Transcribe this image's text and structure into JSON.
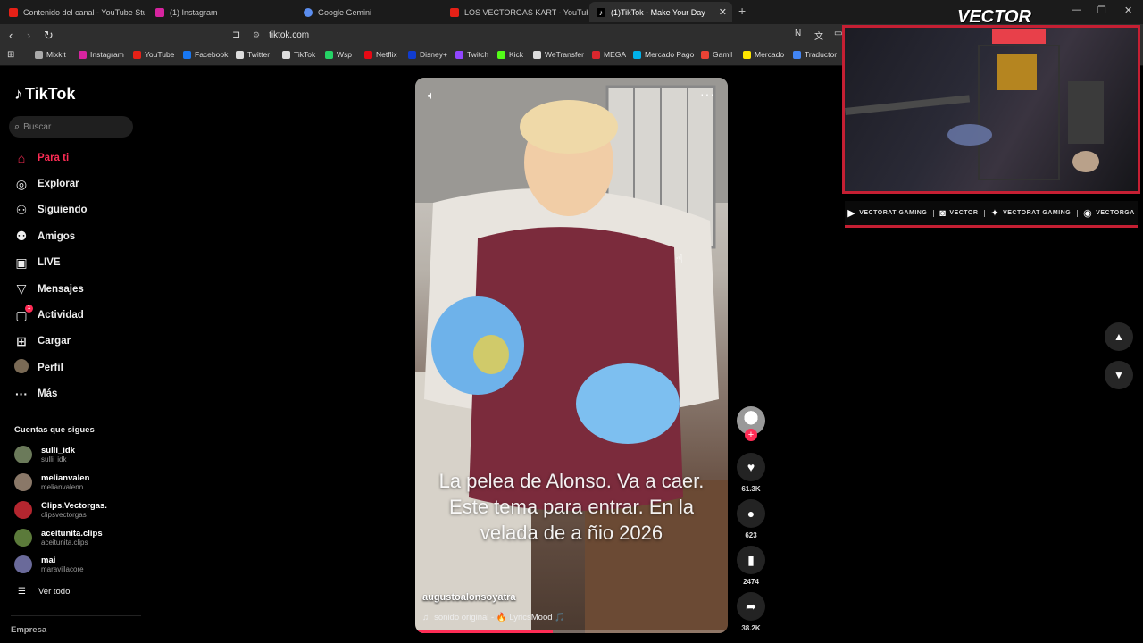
{
  "browser": {
    "tabs": [
      {
        "label": "Contenido del canal - YouTube Studio",
        "color": "#e62117"
      },
      {
        "label": "(1) Instagram",
        "color": "#d6249f"
      },
      {
        "label": "Google Gemini",
        "color": "#5b8def"
      },
      {
        "label": "LOS VECTORGAS KART - YouTube",
        "color": "#e62117"
      },
      {
        "label": "(1)TikTok - Make Your Day",
        "color": "#ffffff"
      }
    ],
    "address": "tiktok.com",
    "bookmarks": [
      {
        "label": "Mixkit",
        "icon": "mixkit-icon",
        "color": "#aaaaaa"
      },
      {
        "label": "Instagram",
        "icon": "instagram-icon",
        "color": "#d6249f"
      },
      {
        "label": "YouTube",
        "icon": "youtube-icon",
        "color": "#e62117"
      },
      {
        "label": "Facebook",
        "icon": "facebook-icon",
        "color": "#1877f2"
      },
      {
        "label": "Twitter",
        "icon": "x-icon",
        "color": "#dddddd"
      },
      {
        "label": "TikTok",
        "icon": "tiktok-icon",
        "color": "#dddddd"
      },
      {
        "label": "Wsp",
        "icon": "whatsapp-icon",
        "color": "#25d366"
      },
      {
        "label": "Netflix",
        "icon": "netflix-icon",
        "color": "#e50914"
      },
      {
        "label": "Disney+",
        "icon": "disney-icon",
        "color": "#113ccf"
      },
      {
        "label": "Twitch",
        "icon": "twitch-icon",
        "color": "#9146ff"
      },
      {
        "label": "Kick",
        "icon": "kick-icon",
        "color": "#53fc18"
      },
      {
        "label": "WeTransfer",
        "icon": "wetransfer-icon",
        "color": "#dddddd"
      },
      {
        "label": "MEGA",
        "icon": "mega-icon",
        "color": "#d9272e"
      },
      {
        "label": "Mercado Pago",
        "icon": "mercadopago-icon",
        "color": "#00b1ea"
      },
      {
        "label": "Gamil",
        "icon": "gmail-icon",
        "color": "#ea4335"
      },
      {
        "label": "Mercado",
        "icon": "mercadolibre-icon",
        "color": "#ffe600"
      },
      {
        "label": "Traductor",
        "icon": "translate-icon",
        "color": "#4285f4"
      }
    ]
  },
  "tiktok": {
    "logo": "TikTok",
    "search_placeholder": "Buscar",
    "nav": [
      {
        "label": "Para ti",
        "icon": "home-icon",
        "glyph": "⌂",
        "active": true
      },
      {
        "label": "Explorar",
        "icon": "compass-icon",
        "glyph": "◎"
      },
      {
        "label": "Siguiendo",
        "icon": "following-icon",
        "glyph": "⚇"
      },
      {
        "label": "Amigos",
        "icon": "friends-icon",
        "glyph": "⚉"
      },
      {
        "label": "LIVE",
        "icon": "live-icon",
        "glyph": "▣"
      },
      {
        "label": "Mensajes",
        "icon": "messages-icon",
        "glyph": "▽"
      },
      {
        "label": "Actividad",
        "icon": "activity-icon",
        "glyph": "▢",
        "badge": "1"
      },
      {
        "label": "Cargar",
        "icon": "upload-icon",
        "glyph": "⊞"
      },
      {
        "label": "Perfil",
        "icon": "profile-avatar",
        "glyph": ""
      },
      {
        "label": "Más",
        "icon": "more-icon",
        "glyph": "···"
      }
    ],
    "following_title": "Cuentas que sigues",
    "accounts": [
      {
        "name": "sulli_idk",
        "handle": "sulli_idk_",
        "color": "#6b7a5a"
      },
      {
        "name": "melianvalen",
        "handle": "melianvalenn",
        "color": "#8a7868"
      },
      {
        "name": "Clips.Vectorgas.",
        "handle": "clipsvectorgas",
        "color": "#b4262f"
      },
      {
        "name": "aceitunita.clips",
        "handle": "aceitunita.clips",
        "color": "#5b7a3a"
      },
      {
        "name": "mai",
        "handle": "maravillacore",
        "color": "#6a6a9a"
      }
    ],
    "see_all": "Ver todo",
    "company": "Empresa"
  },
  "video": {
    "caption": "La pelea de Alonso.  Va a caer. Este tema para entrar. En la velada  de a ñio 2026",
    "author": "augustoalonsoyatra",
    "sound": "sonido original - 🔥 LyricsMood 🎵",
    "progress": 0.44
  },
  "actions": {
    "likes": "61.3K",
    "comments": "623",
    "saves": "2474",
    "shares": "38.2K"
  },
  "overlay": {
    "title": "VECTOR",
    "socials": [
      {
        "label": "VECTORAT GAMING",
        "icon": "youtube-icon",
        "glyph": "▶"
      },
      {
        "label": "VECTOR",
        "icon": "twitch-icon",
        "glyph": "◙"
      },
      {
        "label": "VECTORAT GAMING",
        "icon": "twitter-icon",
        "glyph": "✦"
      },
      {
        "label": "VECTORGA",
        "icon": "instagram-icon",
        "glyph": "◉"
      }
    ]
  }
}
